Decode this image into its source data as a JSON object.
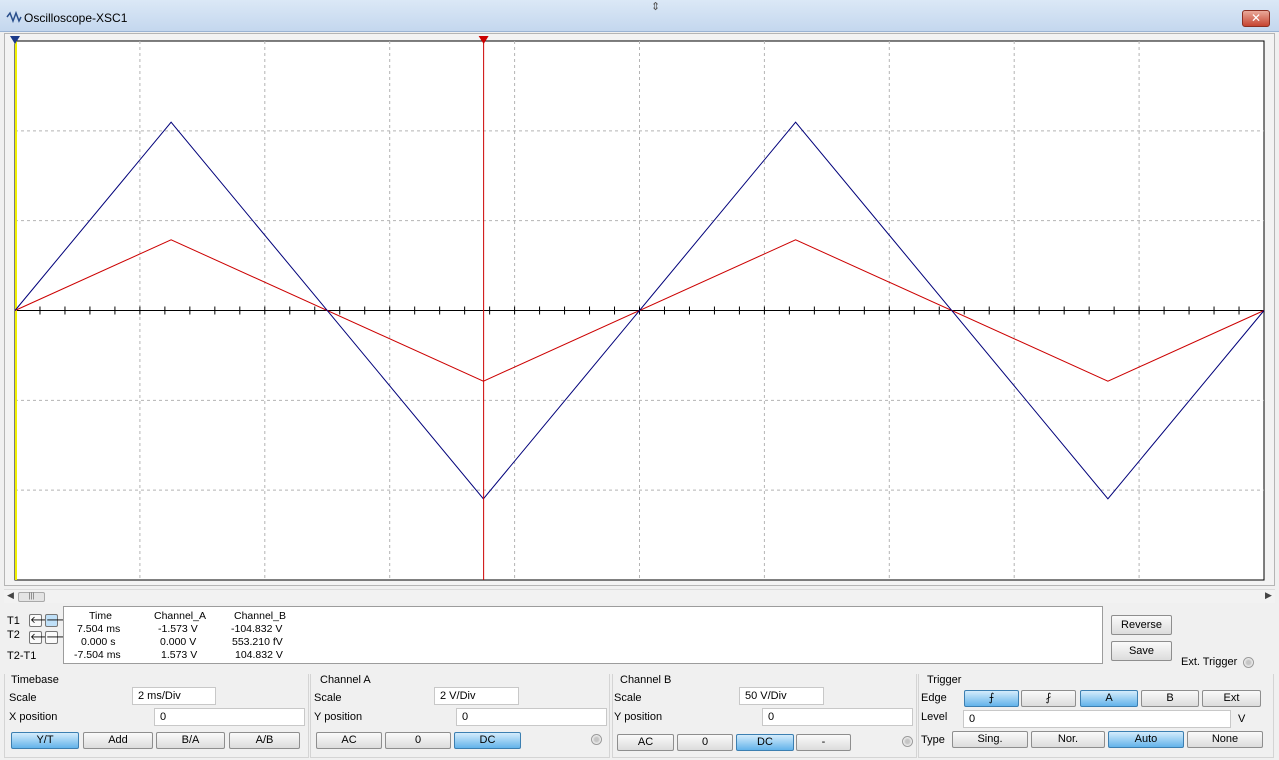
{
  "window": {
    "title": "Oscilloscope-XSC1",
    "close_label": "✕"
  },
  "colors": {
    "channel_a": "#cc0000",
    "channel_b": "#00007a",
    "grid": "#b4b4b4",
    "ext_trigger_line": "#f0f000"
  },
  "chart_data": {
    "type": "line",
    "title": "",
    "xlabel": "",
    "ylabel": "",
    "x_divisions": 10,
    "y_divisions": 6,
    "xlim": [
      0,
      20
    ],
    "ylim_channel_a": [
      -6,
      6
    ],
    "ylim_channel_b": [
      -150,
      150
    ],
    "x_unit": "ms",
    "grid": true,
    "series": [
      {
        "name": "Channel_A",
        "x": [
          0,
          2.5,
          7.5,
          12.5,
          17.5,
          20
        ],
        "y": [
          0,
          1.573,
          -1.573,
          1.573,
          -1.573,
          0
        ]
      },
      {
        "name": "Channel_B",
        "x": [
          0,
          2.5,
          7.5,
          12.5,
          17.5,
          20
        ],
        "y": [
          0,
          104.832,
          -104.832,
          104.832,
          -104.832,
          0
        ]
      }
    ],
    "cursors": [
      {
        "name": "T1",
        "x": 7.504
      },
      {
        "name": "T2",
        "x": 0.0
      }
    ]
  },
  "cursors": {
    "t1_label": "T1",
    "t2_label": "T2",
    "diff_label": "T2-T1",
    "left_arrow": "🡐",
    "right_arrow": "🡒"
  },
  "readout": {
    "headers": [
      "Time",
      "Channel_A",
      "Channel_B"
    ],
    "rows": [
      [
        "7.504 ms",
        "-1.573 V",
        "-104.832 V"
      ],
      [
        "0.000 s",
        "0.000 V",
        "553.210 fV"
      ],
      [
        "-7.504 ms",
        "1.573 V",
        "104.832 V"
      ]
    ]
  },
  "buttons": {
    "reverse": "Reverse",
    "save": "Save",
    "ext_trigger": "Ext. Trigger"
  },
  "timebase": {
    "title": "Timebase",
    "scale_label": "Scale",
    "scale_value": "2 ms/Div",
    "xpos_label": "X position",
    "xpos_value": "0",
    "modes": [
      "Y/T",
      "Add",
      "B/A",
      "A/B"
    ],
    "selected_mode": "Y/T"
  },
  "channel_a": {
    "title": "Channel A",
    "scale_label": "Scale",
    "scale_value": "2  V/Div",
    "ypos_label": "Y position",
    "ypos_value": "0",
    "coupling": [
      "AC",
      "0",
      "DC"
    ],
    "selected": "DC"
  },
  "channel_b": {
    "title": "Channel B",
    "scale_label": "Scale",
    "scale_value": "50  V/Div",
    "ypos_label": "Y position",
    "ypos_value": "0",
    "coupling": [
      "AC",
      "0",
      "DC",
      "-"
    ],
    "selected": "DC"
  },
  "trigger": {
    "title": "Trigger",
    "edge_label": "Edge",
    "edge_rising": "⨍",
    "edge_falling": "⨏",
    "sources": [
      "A",
      "B",
      "Ext"
    ],
    "selected_source": "A",
    "level_label": "Level",
    "level_value": "0",
    "level_unit": "V",
    "type_label": "Type",
    "types": [
      "Sing.",
      "Nor.",
      "Auto",
      "None"
    ],
    "selected_type": "Auto"
  },
  "scrollbar": {
    "left_arrow": "◀",
    "right_arrow": "▶",
    "thumb_grip": "|||"
  },
  "move_icon": "⇕"
}
